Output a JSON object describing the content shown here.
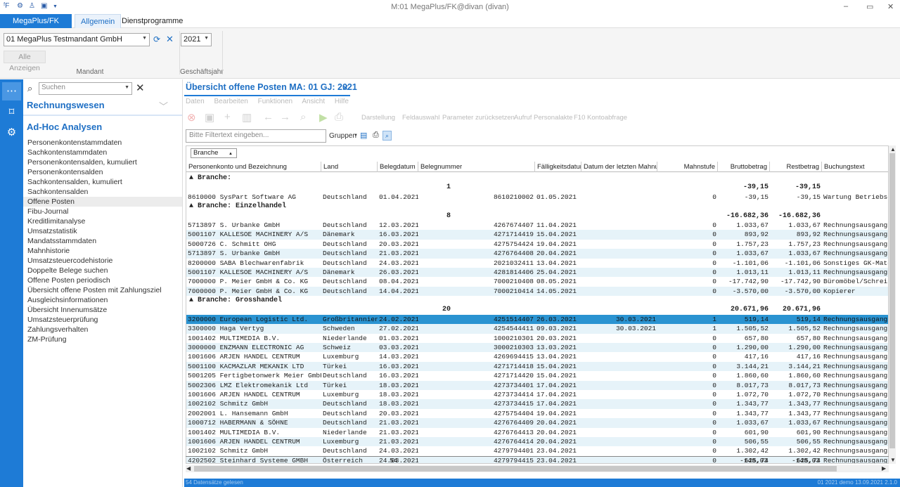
{
  "window": {
    "title": "M:01 MegaPlus/FK@divan (divan)",
    "controls": [
      "–",
      "▭",
      "✕"
    ]
  },
  "ribbon": {
    "app_tab": "MegaPlus/FK",
    "tabs": [
      "Allgemein",
      "Dienstprogramme"
    ],
    "mandant_value": "01 MegaPlus Testmandant GmbH",
    "alle_anzeigen": "Alle Anzeigen",
    "group_mandant": "Mandant",
    "year_value": "2021",
    "group_gj": "Geschäftsjahr"
  },
  "nav": {
    "search_placeholder": "Suchen",
    "section1": "Rechnungswesen",
    "section2": "Ad-Hoc Analysen",
    "items": [
      "Personenkontenstammdaten",
      "Sachkontenstammdaten",
      "Personenkontensalden, kumuliert",
      "Personenkontensalden",
      "Sachkontensalden, kumuliert",
      "Sachkontensalden",
      "Offene Posten",
      "Fibu-Journal",
      "Kreditlimitanalyse",
      "Umsatzstatistik",
      "Mandatsstammdaten",
      "Mahnhistorie",
      "Umsatzsteuercodehistorie",
      "Doppelte Belege suchen",
      "Offene Posten periodisch",
      "Übersicht offene Posten mit Zahlungsziel",
      "Ausgleichsinformationen",
      "Übersicht Innenumsätze",
      "Umsatzsteuerprüfung",
      "Zahlungsverhalten",
      "ZM-Prüfung"
    ],
    "selected_index": 6
  },
  "document": {
    "tab_title": "Übersicht offene Posten MA: 01 GJ: 2021",
    "menu": [
      "Daten",
      "Bearbeiten",
      "Funktionen",
      "Ansicht",
      "Hilfe"
    ],
    "toolbar_texts": [
      "Darstellung",
      "Feldauswahl",
      "Parameter zurücksetzen",
      "Aufruf Personalakte",
      "F10 Kontoabfrage"
    ],
    "filter_placeholder": "Bitte Filtertext eingeben...",
    "gruppen_label": "Gruppen",
    "group_chip": "Branche"
  },
  "grid": {
    "columns": [
      "Personenkonto und Bezeichnung",
      "Land",
      "Belegdatum",
      "Belegnummer",
      "Fälligkeitsdatum",
      "Datum der letzten Mahnung",
      "Mahnstufe",
      "Bruttobetrag",
      "Restbetrag",
      "Buchungstext"
    ],
    "groups": [
      {
        "header": "▲ Branche:",
        "count": "1",
        "sum_brutto": "-39,15",
        "sum_rest": "-39,15",
        "rows": [
          [
            "8610000 SysPart Software AG",
            "Deutschland",
            "01.04.2021",
            "8610210002",
            "01.05.2021",
            "",
            "0",
            "-39,15",
            "-39,15",
            "Wartung Betriebsda"
          ]
        ]
      },
      {
        "header": "▲ Branche: Einzelhandel",
        "count": "8",
        "sum_brutto": "-16.682,36",
        "sum_rest": "-16.682,36",
        "rows": [
          [
            "5713897 S. Urbanke GmbH",
            "Deutschland",
            "12.03.2021",
            "4267674407",
            "11.04.2021",
            "",
            "0",
            "1.033,67",
            "1.033,67",
            "Rechnungsausgang"
          ],
          [
            "5001107 KALLESOE MACHINERY A/S",
            "Dänemark",
            "16.03.2021",
            "4271714419",
            "15.04.2021",
            "",
            "0",
            "893,92",
            "893,92",
            "Rechnungsausgang"
          ],
          [
            "5000726 C. Schmitt OHG",
            "Deutschland",
            "20.03.2021",
            "4275754424",
            "19.04.2021",
            "",
            "0",
            "1.757,23",
            "1.757,23",
            "Rechnungsausgang"
          ],
          [
            "5713897 S. Urbanke GmbH",
            "Deutschland",
            "21.03.2021",
            "4276764408",
            "20.04.2021",
            "",
            "0",
            "1.033,67",
            "1.033,67",
            "Rechnungsausgang"
          ],
          [
            "8200000 SABA Blechwarenfabrik",
            "Deutschland",
            "24.03.2021",
            "2021032411",
            "13.04.2021",
            "",
            "0",
            "-1.101,06",
            "-1.101,06",
            "Sonstiges GK-Mater"
          ],
          [
            "5001107 KALLESOE MACHINERY A/S",
            "Dänemark",
            "26.03.2021",
            "4281814406",
            "25.04.2021",
            "",
            "0",
            "1.013,11",
            "1.013,11",
            "Rechnungsausgang"
          ],
          [
            "7000000 P. Meier GmbH & Co. KG",
            "Deutschland",
            "08.04.2021",
            "7000210408",
            "08.05.2021",
            "",
            "0",
            "-17.742,90",
            "-17.742,90",
            "Büromöbel/Schreibt"
          ],
          [
            "7000000 P. Meier GmbH & Co. KG",
            "Deutschland",
            "14.04.2021",
            "7000210414",
            "14.05.2021",
            "",
            "0",
            "-3.570,00",
            "-3.570,00",
            "Kopierer"
          ]
        ]
      },
      {
        "header": "▲ Branche: Grosshandel",
        "count": "20",
        "sum_brutto": "20.671,96",
        "sum_rest": "20.671,96",
        "rows": [
          [
            "3200000 European Logistic Ltd.",
            "Großbritannien",
            "24.02.2021",
            "4251514407",
            "26.03.2021",
            "30.03.2021",
            "1",
            "519,14",
            "519,14",
            "Rechnungsausgang"
          ],
          [
            "3300000 Haga Vertyg",
            "Schweden",
            "27.02.2021",
            "4254544411",
            "09.03.2021",
            "30.03.2021",
            "1",
            "1.505,52",
            "1.505,52",
            "Rechnungsausgang"
          ],
          [
            "1001402 MULTIMEDIA B.V.",
            "Niederlande",
            "01.03.2021",
            "1000210301",
            "20.03.2021",
            "",
            "0",
            "657,80",
            "657,80",
            "Rechnungsausgang"
          ],
          [
            "3000000 ENZMANN ELECTRONIC AG",
            "Schweiz",
            "03.03.2021",
            "3000210303",
            "13.03.2021",
            "",
            "0",
            "1.290,00",
            "1.290,00",
            "Rechnungsausgang"
          ],
          [
            "1001606 ARJEN HANDEL CENTRUM",
            "Luxemburg",
            "14.03.2021",
            "4269694415",
            "13.04.2021",
            "",
            "0",
            "417,16",
            "417,16",
            "Rechnungsausgang"
          ],
          [
            "5001100 KACMAZLAR MEKANIK LTD",
            "Türkei",
            "16.03.2021",
            "4271714418",
            "15.04.2021",
            "",
            "0",
            "3.144,21",
            "3.144,21",
            "Rechnungsausgang"
          ],
          [
            "5001205 Fertigbetonwerk Meier GmbH",
            "Deutschland",
            "16.03.2021",
            "4271714420",
            "15.04.2021",
            "",
            "0",
            "1.860,60",
            "1.860,60",
            "Rechnungsausgang"
          ],
          [
            "5002306 LMZ Elektromekanik Ltd",
            "Türkei",
            "18.03.2021",
            "4273734401",
            "17.04.2021",
            "",
            "0",
            "8.017,73",
            "8.017,73",
            "Rechnungsausgang"
          ],
          [
            "1001606 ARJEN HANDEL CENTRUM",
            "Luxemburg",
            "18.03.2021",
            "4273734414",
            "17.04.2021",
            "",
            "0",
            "1.072,70",
            "1.072,70",
            "Rechnungsausgang"
          ],
          [
            "1002102 Schmitz GmbH",
            "Deutschland",
            "18.03.2021",
            "4273734415",
            "17.04.2021",
            "",
            "0",
            "1.343,77",
            "1.343,77",
            "Rechnungsausgang"
          ],
          [
            "2002001 L. Hansemann GmbH",
            "Deutschland",
            "20.03.2021",
            "4275754404",
            "19.04.2021",
            "",
            "0",
            "1.343,77",
            "1.343,77",
            "Rechnungsausgang"
          ],
          [
            "1000712 HABERMANN & SÖHNE",
            "Deutschland",
            "21.03.2021",
            "4276764409",
            "20.04.2021",
            "",
            "0",
            "1.033,67",
            "1.033,67",
            "Rechnungsausgang"
          ],
          [
            "1001402 MULTIMEDIA B.V.",
            "Niederlande",
            "21.03.2021",
            "4276764413",
            "20.04.2021",
            "",
            "0",
            "601,90",
            "601,90",
            "Rechnungsausgang"
          ],
          [
            "1001606 ARJEN HANDEL CENTRUM",
            "Luxemburg",
            "21.03.2021",
            "4276764414",
            "20.04.2021",
            "",
            "0",
            "506,55",
            "506,55",
            "Rechnungsausgang"
          ],
          [
            "1002102 Schmitz GmbH",
            "Deutschland",
            "24.03.2021",
            "4279794401",
            "23.04.2021",
            "",
            "0",
            "1.302,42",
            "1.302,42",
            "Rechnungsausgang"
          ],
          [
            "4202502 Steinhard Systeme GMBH",
            "Österreich",
            "24.03.2021",
            "4279794415",
            "23.04.2021",
            "",
            "0",
            "625,74",
            "625,74",
            "Rechnungsausgang"
          ]
        ]
      }
    ],
    "selected_row": "3200000 European Logistic Ltd.",
    "footer": {
      "count": "54",
      "brutto": "-148,03",
      "rest": "-148,03"
    }
  },
  "status": {
    "left": "54 Datensätze gelesen",
    "right": "01  2021  demo  13.09.2021  2.1.0"
  },
  "colors": {
    "accent": "#1e7bd6",
    "selected_row": "#2a93d1",
    "alt_row": "#e6f3f9"
  }
}
